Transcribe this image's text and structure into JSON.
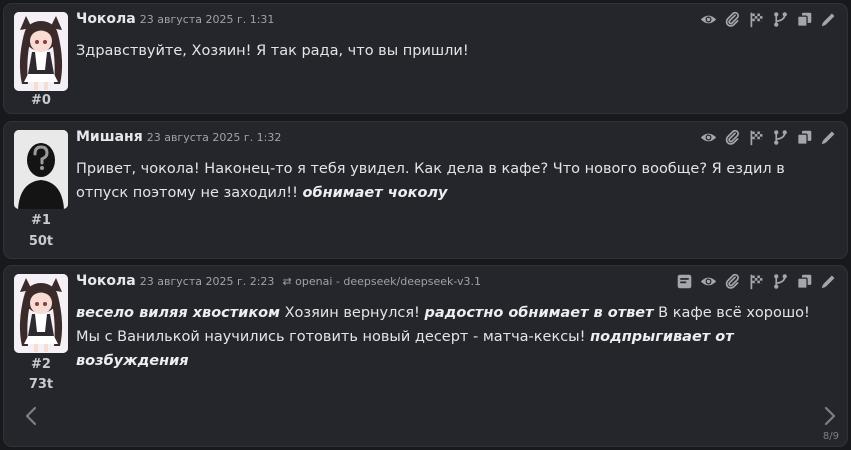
{
  "messages": [
    {
      "name": "Чокола",
      "timestamp": "23 августа 2025 г. 1:31",
      "id": "#0",
      "tokens": "",
      "text": "Здравствуйте, Хозяин! Я так рада, что вы пришли!",
      "avatar": "catgirl-avatar"
    },
    {
      "name": "Мишаня",
      "timestamp": "23 августа 2025 г. 1:32",
      "id": "#1",
      "tokens": "50t",
      "text_plain": "Привет, чокола! Наконец-то я тебя увидел. Как дела в кафе? Что нового вообще? Я ездил в отпуск поэтому не заходил!! ",
      "text_em": "обнимает чоколу",
      "avatar": "silhouette-avatar"
    },
    {
      "name": "Чокола",
      "timestamp": "23 августа 2025 г. 2:23",
      "model": "openai - deepseek/deepseek-v3.1",
      "id": "#2",
      "tokens": "73t",
      "parts": [
        {
          "em": true,
          "t": "весело виляя хвостиком"
        },
        {
          "em": false,
          "t": " Хозяин вернулся! "
        },
        {
          "em": true,
          "t": "радостно обнимает в ответ"
        },
        {
          "em": false,
          "t": " В кафе всё хорошо! Мы с Ванилькой научились готовить новый десерт - матча-кексы! "
        },
        {
          "em": true,
          "t": "подпрыгивает от возбуждения"
        }
      ],
      "swipe_counter": "8/9",
      "avatar": "catgirl-avatar"
    }
  ],
  "icons": {
    "standard": [
      "eye-icon",
      "paperclip-icon",
      "flag-icon",
      "branch-icon",
      "copy-icon",
      "pencil-icon"
    ],
    "last_extra": "notes-icon",
    "swipe_left": "chevron-left-icon",
    "swipe_right": "chevron-right-icon"
  },
  "colors": {
    "background": "#17191c",
    "card": "#24262b",
    "text": "#e3e4e7",
    "muted": "#9ea2a9",
    "icon": "#a3a6ad"
  }
}
